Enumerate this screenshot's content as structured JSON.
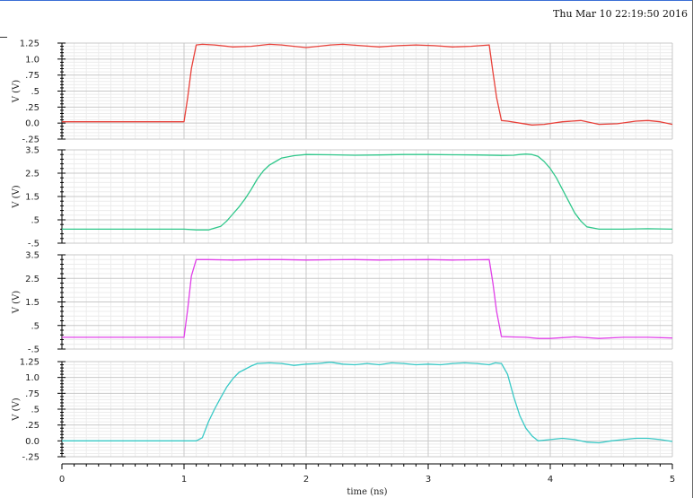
{
  "timestamp": "Thu Mar 10 22:19:50 2016",
  "xlabel": "time (ns)",
  "xlim": [
    0,
    5
  ],
  "x_ticks": [
    0,
    1,
    2,
    3,
    4,
    5
  ],
  "x_tick_labels": [
    "0",
    "1",
    "2",
    "3",
    "4",
    "5"
  ],
  "colors": {
    "axis": "#000000",
    "grid_major": "#c8c8c8",
    "grid_minor": "#ececec"
  },
  "chart_data": [
    {
      "type": "line",
      "ylabel": "V (V)",
      "ylim": [
        -0.25,
        1.25
      ],
      "y_ticks": [
        -0.25,
        0,
        0.25,
        0.5,
        0.75,
        1.0,
        1.25
      ],
      "y_tick_labels": [
        "-.25",
        "0.0",
        ".25",
        ".5",
        ".75",
        "1.0",
        "1.25"
      ],
      "grid": true,
      "series": [
        {
          "color": "#e8413a",
          "x": [
            0,
            0.5,
            1.0,
            1.03,
            1.06,
            1.1,
            1.15,
            1.25,
            1.4,
            1.55,
            1.7,
            1.8,
            1.9,
            2.0,
            2.1,
            2.2,
            2.3,
            2.45,
            2.6,
            2.75,
            2.9,
            3.05,
            3.2,
            3.35,
            3.5,
            3.53,
            3.56,
            3.6,
            3.65,
            3.75,
            3.85,
            3.95,
            4.1,
            4.25,
            4.4,
            4.55,
            4.7,
            4.8,
            4.9,
            5.0
          ],
          "y": [
            0.02,
            0.02,
            0.02,
            0.4,
            0.85,
            1.22,
            1.23,
            1.22,
            1.19,
            1.2,
            1.23,
            1.22,
            1.2,
            1.18,
            1.2,
            1.22,
            1.23,
            1.21,
            1.19,
            1.21,
            1.22,
            1.21,
            1.19,
            1.2,
            1.22,
            0.8,
            0.4,
            0.04,
            0.03,
            0.0,
            -0.03,
            -0.02,
            0.02,
            0.04,
            -0.02,
            -0.01,
            0.03,
            0.04,
            0.02,
            -0.02
          ]
        }
      ]
    },
    {
      "type": "line",
      "ylabel": "V (V)",
      "ylim": [
        -0.5,
        3.5
      ],
      "y_ticks": [
        -0.5,
        0.5,
        1.5,
        2.5,
        3.5
      ],
      "y_tick_labels": [
        "-.5",
        ".5",
        "1.5",
        "2.5",
        "3.5"
      ],
      "grid": true,
      "series": [
        {
          "color": "#2fc78a",
          "x": [
            0,
            0.5,
            1.0,
            1.1,
            1.2,
            1.3,
            1.35,
            1.4,
            1.45,
            1.5,
            1.55,
            1.6,
            1.65,
            1.7,
            1.75,
            1.8,
            1.9,
            2.0,
            2.2,
            2.4,
            2.6,
            2.8,
            3.0,
            3.2,
            3.4,
            3.6,
            3.7,
            3.75,
            3.8,
            3.85,
            3.9,
            3.95,
            4.0,
            4.05,
            4.1,
            4.15,
            4.2,
            4.25,
            4.3,
            4.4,
            4.6,
            4.8,
            5.0
          ],
          "y": [
            0.1,
            0.1,
            0.1,
            0.07,
            0.07,
            0.22,
            0.45,
            0.75,
            1.05,
            1.4,
            1.8,
            2.25,
            2.6,
            2.85,
            3.0,
            3.15,
            3.25,
            3.3,
            3.29,
            3.27,
            3.28,
            3.3,
            3.3,
            3.29,
            3.28,
            3.26,
            3.27,
            3.3,
            3.32,
            3.3,
            3.22,
            3.0,
            2.7,
            2.3,
            1.8,
            1.3,
            0.8,
            0.45,
            0.2,
            0.1,
            0.1,
            0.12,
            0.1
          ]
        }
      ]
    },
    {
      "type": "line",
      "ylabel": "V (V)",
      "ylim": [
        -0.5,
        3.5
      ],
      "y_ticks": [
        -0.5,
        0.5,
        1.5,
        2.5,
        3.5
      ],
      "y_tick_labels": [
        "-.5",
        ".5",
        "1.5",
        "2.5",
        "3.5"
      ],
      "grid": true,
      "series": [
        {
          "color": "#e040e8",
          "x": [
            0,
            0.5,
            1.0,
            1.03,
            1.06,
            1.1,
            1.2,
            1.4,
            1.6,
            1.8,
            2.0,
            2.2,
            2.4,
            2.6,
            2.8,
            3.0,
            3.2,
            3.4,
            3.5,
            3.53,
            3.56,
            3.6,
            3.65,
            3.8,
            3.9,
            4.0,
            4.2,
            4.4,
            4.6,
            4.8,
            5.0
          ],
          "y": [
            0.0,
            0.0,
            0.0,
            1.2,
            2.6,
            3.3,
            3.3,
            3.28,
            3.3,
            3.3,
            3.28,
            3.29,
            3.3,
            3.28,
            3.29,
            3.3,
            3.28,
            3.29,
            3.3,
            2.3,
            1.1,
            0.03,
            0.02,
            0.0,
            -0.05,
            -0.05,
            0.02,
            -0.05,
            0.0,
            0.0,
            -0.03
          ]
        }
      ]
    },
    {
      "type": "line",
      "ylabel": "V (V)",
      "ylim": [
        -0.25,
        1.25
      ],
      "y_ticks": [
        -0.25,
        0,
        0.25,
        0.5,
        0.75,
        1.0,
        1.25
      ],
      "y_tick_labels": [
        "-.25",
        "0.0",
        ".25",
        ".5",
        ".75",
        "1.0",
        "1.25"
      ],
      "grid": true,
      "series": [
        {
          "color": "#38c9c6",
          "x": [
            0,
            0.5,
            1.0,
            1.1,
            1.15,
            1.2,
            1.25,
            1.3,
            1.35,
            1.4,
            1.45,
            1.5,
            1.55,
            1.6,
            1.7,
            1.8,
            1.9,
            2.0,
            2.1,
            2.2,
            2.3,
            2.4,
            2.5,
            2.6,
            2.7,
            2.8,
            2.9,
            3.0,
            3.1,
            3.2,
            3.3,
            3.4,
            3.5,
            3.55,
            3.6,
            3.65,
            3.7,
            3.75,
            3.8,
            3.85,
            3.9,
            4.0,
            4.1,
            4.2,
            4.3,
            4.4,
            4.5,
            4.6,
            4.7,
            4.8,
            4.9,
            5.0
          ],
          "y": [
            0.0,
            0.0,
            0.0,
            0.0,
            0.05,
            0.3,
            0.5,
            0.68,
            0.85,
            0.98,
            1.08,
            1.13,
            1.18,
            1.22,
            1.23,
            1.22,
            1.19,
            1.21,
            1.22,
            1.24,
            1.21,
            1.2,
            1.22,
            1.2,
            1.23,
            1.22,
            1.2,
            1.21,
            1.2,
            1.22,
            1.23,
            1.22,
            1.2,
            1.23,
            1.22,
            1.05,
            0.7,
            0.4,
            0.2,
            0.08,
            0.0,
            0.02,
            0.04,
            0.02,
            -0.02,
            -0.03,
            0.0,
            0.02,
            0.04,
            0.04,
            0.02,
            -0.01
          ]
        }
      ]
    }
  ]
}
